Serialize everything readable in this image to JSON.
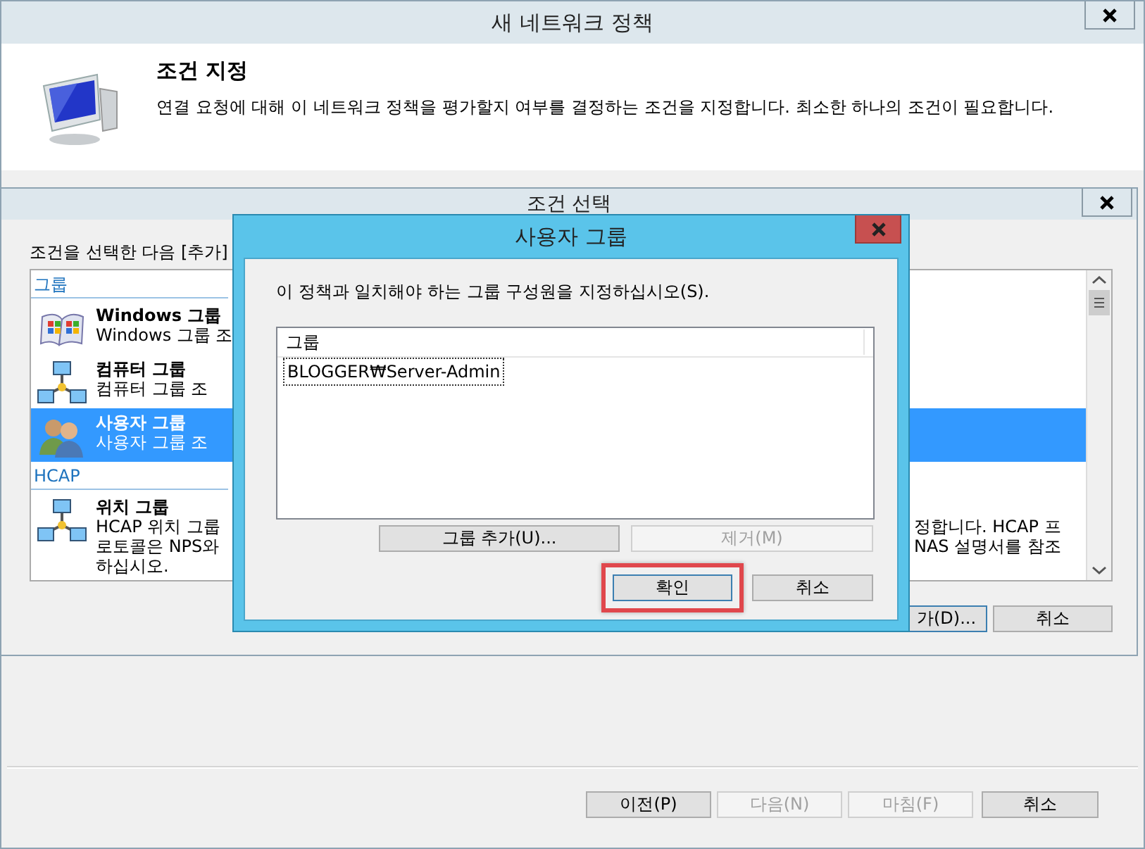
{
  "main_window": {
    "title": "새 네트워크 정책",
    "heading": "조건 지정",
    "description": "연결 요청에 대해 이 네트워크 정책을 평가할지 여부를 결정하는 조건을 지정합니다. 최소한 하나의 조건이 필요합니다.",
    "buttons": [
      {
        "label": "이전(P)",
        "disabled": false
      },
      {
        "label": "다음(N)",
        "disabled": true
      },
      {
        "label": "마침(F)",
        "disabled": true
      },
      {
        "label": "취소",
        "disabled": false
      }
    ]
  },
  "condition_window": {
    "title": "조건 선택",
    "instruction": "조건을 선택한 다음 [추가]",
    "groups": [
      {
        "header": "그룹",
        "items": [
          {
            "kind": "windows",
            "name": "Windows 그룹",
            "lines": [
              "Windows 그룹 조"
            ],
            "selected": false
          },
          {
            "kind": "network",
            "name": "컴퓨터 그룹",
            "lines": [
              "컴퓨터 그룹 조"
            ],
            "selected": false
          },
          {
            "kind": "users",
            "name": "사용자 그룹",
            "lines": [
              "사용자 그룹 조"
            ],
            "selected": true
          }
        ]
      },
      {
        "header": "HCAP",
        "items": [
          {
            "kind": "network",
            "name": "위치 그룹",
            "lines": [
              "HCAP 위치 그룹",
              "로토콜은 NPS와",
              "하십시오."
            ],
            "right_lines": [
              "정합니다. HCAP 프",
              "NAS 설명서를 참조"
            ],
            "selected": false
          }
        ]
      }
    ],
    "buttons": [
      {
        "label": "가(D)...",
        "default": true
      },
      {
        "label": "취소",
        "default": false
      }
    ]
  },
  "dialog": {
    "title": "사용자 그룹",
    "instruction": "이 정책과 일치해야 하는 그룹 구성원을 지정하십시오(S).",
    "column": "그룹",
    "rows": [
      {
        "text": "BLOGGER₩Server-Admin",
        "focused": true
      }
    ],
    "list_buttons": [
      {
        "label": "그룹 추가(U)...",
        "disabled": false
      },
      {
        "label": "제거(M)",
        "disabled": true
      }
    ],
    "buttons": [
      {
        "label": "확인",
        "highlighted": true,
        "default": true
      },
      {
        "label": "취소",
        "highlighted": false,
        "default": false
      }
    ]
  }
}
